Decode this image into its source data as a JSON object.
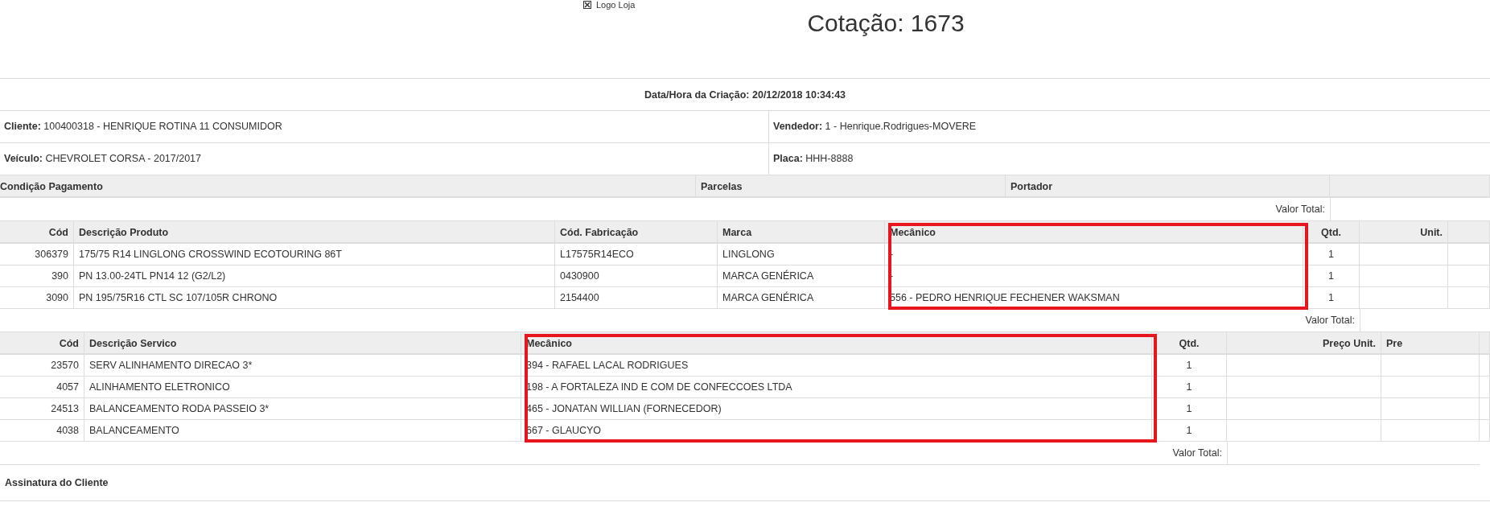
{
  "logo": {
    "alt": "Logo Loja"
  },
  "title": "Cotação: 1673",
  "created": "Data/Hora da Criação: 20/12/2018 10:34:43",
  "info_rows": [
    [
      {
        "text": "**Cliente:** 100400318 - HENRIQUE ROTINA 11 CONSUMIDOR"
      },
      {
        "text": "**Vendedor:** 1 - Henrique.Rodrigues-MOVERE"
      }
    ],
    [
      {
        "text": "**Veículo:** CHEVROLET CORSA - 2017/2017"
      },
      {
        "text": "**Placa:** HHH-8888"
      }
    ]
  ],
  "payment": {
    "columns": [
      "Condição Pagamento",
      "Parcelas",
      "Portador"
    ],
    "total_label": "Valor Total:"
  },
  "products": {
    "columns": [
      {
        "label": "Cód",
        "kind": "code",
        "highlighted": false
      },
      {
        "label": "Descrição Produto",
        "kind": "text",
        "highlighted": false
      },
      {
        "label": "Cód. Fabricação",
        "kind": "text",
        "highlighted": false
      },
      {
        "label": "Marca",
        "kind": "text",
        "highlighted": false
      },
      {
        "label": "Mecânico",
        "kind": "text",
        "highlighted": true
      },
      {
        "label": "Qtd.",
        "kind": "qty",
        "highlighted": false
      },
      {
        "label": "Unit.",
        "kind": "price",
        "highlighted": false
      }
    ],
    "rows": [
      [
        "306379",
        "175/75 R14 LINGLONG CROSSWIND ECOTOURING 86T",
        "L17575R14ECO",
        "LINGLONG",
        "-",
        "1"
      ],
      [
        "390",
        "PN 13.00-24TL PN14 12 (G2/L2)",
        "0430900",
        "MARCA GENÉRICA",
        "-",
        "1"
      ],
      [
        "3090",
        "PN 195/75R16 CTL SC 107/105R CHRONO",
        "2154400",
        "MARCA GENÉRICA",
        "556 - PEDRO HENRIQUE FECHENER WAKSMAN",
        "1"
      ]
    ],
    "total_label": "Valor Total:"
  },
  "services": {
    "columns": [
      {
        "label": "Cód",
        "kind": "code",
        "highlighted": false
      },
      {
        "label": "Descrição Servico",
        "kind": "text",
        "highlighted": false
      },
      {
        "label": "Mecânico",
        "kind": "text",
        "highlighted": true
      },
      {
        "label": "Qtd.",
        "kind": "qty",
        "highlighted": false
      },
      {
        "label": "Preço Unit.",
        "kind": "price",
        "highlighted": false
      },
      {
        "label": "Pre",
        "kind": "text",
        "highlighted": false
      }
    ],
    "rows": [
      [
        "23570",
        "SERV ALINHAMENTO DIRECAO 3*",
        "394 - RAFAEL LACAL RODRIGUES",
        "1"
      ],
      [
        "4057",
        "ALINHAMENTO ELETRONICO",
        "198 - A FORTALEZA IND E COM DE CONFECCOES LTDA",
        "1"
      ],
      [
        "24513",
        "BALANCEAMENTO RODA PASSEIO 3*",
        "465 - JONATAN WILLIAN (FORNECEDOR)",
        "1"
      ],
      [
        "4038",
        "BALANCEAMENTO",
        "667 - GLAUCYO",
        "1"
      ]
    ],
    "total_label": "Valor Total:"
  },
  "signature": "Assinatura do Cliente"
}
